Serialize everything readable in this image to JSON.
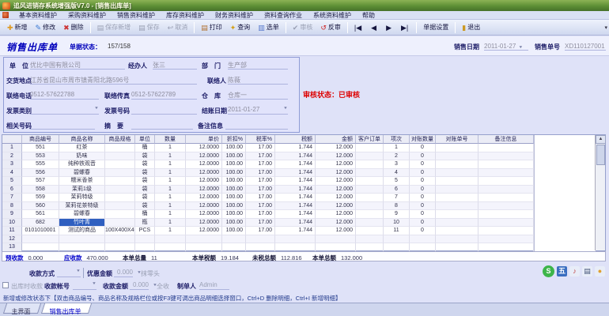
{
  "colors": {
    "accent": "#0000cc",
    "audit_red": "#dd0000",
    "selection": "#2f5fc0",
    "titlebar_green": "#5d8f35"
  },
  "window": {
    "title": "追风进销存系统增强版V7.0 - [销售出库单]"
  },
  "menu_bar": {
    "items": [
      "基本资料维护",
      "采购资料维护",
      "销售资料维护",
      "库存资料维护",
      "财务资料维护",
      "资料查询作业",
      "系统资料维护",
      "帮助"
    ]
  },
  "toolbar": {
    "items": [
      {
        "name": "new-button",
        "label": "新增",
        "icon": "✚",
        "color": "#e09a20"
      },
      {
        "name": "edit-button",
        "label": "修改",
        "icon": "✎",
        "color": "#3a7ad4"
      },
      {
        "name": "delete-button",
        "label": "删除",
        "icon": "✖",
        "color": "#cc3333"
      },
      {
        "sep": true
      },
      {
        "name": "save-new-button",
        "label": "保存新增",
        "icon": "▤",
        "disabled": true
      },
      {
        "name": "save-button",
        "label": "保存",
        "icon": "▤",
        "disabled": true
      },
      {
        "name": "cancel-button",
        "label": "取消",
        "icon": "↩",
        "disabled": true
      },
      {
        "sep": true
      },
      {
        "name": "print-button",
        "label": "打印",
        "icon": "▤",
        "color": "#b07030"
      },
      {
        "name": "query-button",
        "label": "查询",
        "icon": "✦",
        "color": "#d4a017"
      },
      {
        "name": "select-order-button",
        "label": "选单",
        "icon": "▥",
        "color": "#5577cc"
      },
      {
        "sep": true
      },
      {
        "name": "audit-button",
        "label": "审核",
        "icon": "✔",
        "disabled": true
      },
      {
        "name": "reverse-audit-button",
        "label": "反审",
        "icon": "↺",
        "color": "#cc2222"
      },
      {
        "sep": true
      },
      {
        "name": "nav-first-button",
        "icon": "|◀",
        "color": "#16163f"
      },
      {
        "name": "nav-prev-button",
        "icon": "◀",
        "color": "#16163f"
      },
      {
        "name": "nav-next-button",
        "icon": "▶",
        "color": "#16163f"
      },
      {
        "name": "nav-last-button",
        "icon": "▶|",
        "color": "#16163f"
      },
      {
        "sep": true
      },
      {
        "name": "doc-settings-button",
        "label": "单据设置"
      },
      {
        "sep": true
      },
      {
        "name": "exit-button",
        "label": "退出",
        "icon": "▮",
        "color": "#cc9922"
      }
    ]
  },
  "doc_header": {
    "title": "销售出库单",
    "status_label": "单据状态：",
    "status_value": "157/158",
    "date_label": "销售日期",
    "date_value": "2011-01-27",
    "no_label": "销售单号",
    "no_value": "XD110127001"
  },
  "form": {
    "unit_label": "单　位",
    "unit_value": "优比中国有限公司",
    "agent_label": "经办人",
    "agent_value": "张三",
    "dept_label": "部　门",
    "dept_value": "生产部",
    "address_label": "交货地点",
    "address_value": "江苏省昆山市周市镇青阳北路596号",
    "contact_label": "联络人",
    "contact_value": "陈薇",
    "phone_label": "联络电话",
    "phone_value": "0512-57622788",
    "fax_label": "联络传真",
    "fax_value": "0512-57622789",
    "warehouse_label": "仓　库",
    "warehouse_value": "仓库一",
    "invoice_type_label": "发票类别",
    "invoice_type_value": "",
    "invoice_no_label": "发票号码",
    "invoice_no_value": "",
    "settle_date_label": "结账日期",
    "settle_date_value": "2011-01-27",
    "ref_no_label": "相关号码",
    "ref_no_value": "",
    "summary_label": "摘　要",
    "summary_value": "",
    "remark_label": "备注信息",
    "remark_value": ""
  },
  "audit_status": {
    "text": "审核状态：已审核"
  },
  "table": {
    "columns": [
      "商品编号",
      "商品名称",
      "商品规格",
      "单位",
      "数量",
      "单价",
      "折扣%",
      "税率%",
      "税额",
      "金额",
      "客户订单",
      "项次",
      "对账数量",
      "对账单号",
      "备注信息"
    ],
    "rows": [
      [
        "551",
        "红茶",
        "",
        "桶",
        "1",
        "12.0000",
        "100.00",
        "17.00",
        "1.744",
        "12.000",
        "",
        "1",
        "0",
        "",
        ""
      ],
      [
        "553",
        "奶味",
        "",
        "袋",
        "1",
        "12.0000",
        "100.00",
        "17.00",
        "1.744",
        "12.000",
        "",
        "2",
        "0",
        "",
        ""
      ],
      [
        "555",
        "纯种铁观音",
        "",
        "袋",
        "1",
        "12.0000",
        "100.00",
        "17.00",
        "1.744",
        "12.000",
        "",
        "3",
        "0",
        "",
        ""
      ],
      [
        "556",
        "碧螺春",
        "",
        "袋",
        "1",
        "12.0000",
        "100.00",
        "17.00",
        "1.744",
        "12.000",
        "",
        "4",
        "0",
        "",
        ""
      ],
      [
        "557",
        "糯米香茶",
        "",
        "袋",
        "1",
        "12.0000",
        "100.00",
        "17.00",
        "1.744",
        "12.000",
        "",
        "5",
        "0",
        "",
        ""
      ],
      [
        "558",
        "茉莉1级",
        "",
        "袋",
        "1",
        "12.0000",
        "100.00",
        "17.00",
        "1.744",
        "12.000",
        "",
        "6",
        "0",
        "",
        ""
      ],
      [
        "559",
        "茉莉特级",
        "",
        "袋",
        "1",
        "12.0000",
        "100.00",
        "17.00",
        "1.744",
        "12.000",
        "",
        "7",
        "0",
        "",
        ""
      ],
      [
        "560",
        "茉莉花茶特级",
        "",
        "袋",
        "1",
        "12.0000",
        "100.00",
        "17.00",
        "1.744",
        "12.000",
        "",
        "8",
        "0",
        "",
        ""
      ],
      [
        "561",
        "碧螺春",
        "",
        "桶",
        "1",
        "12.0000",
        "100.00",
        "17.00",
        "1.744",
        "12.000",
        "",
        "9",
        "0",
        "",
        ""
      ],
      [
        "682",
        "竹叶青",
        "",
        "瓶",
        "1",
        "12.0000",
        "100.00",
        "17.00",
        "1.744",
        "12.000",
        "",
        "10",
        "0",
        "",
        ""
      ],
      [
        "0101010001",
        "测试的商品",
        "100X400X40",
        "PCS",
        "1",
        "12.0000",
        "100.00",
        "17.00",
        "1.744",
        "12.000",
        "",
        "11",
        "0",
        "",
        ""
      ]
    ],
    "extra_row_numbers": [
      "12",
      "13"
    ],
    "selected": {
      "row": 9,
      "col": 1
    }
  },
  "totals": {
    "items": [
      {
        "label": "预收款",
        "value": "0.000",
        "accent": true
      },
      {
        "label": "应收款",
        "value": "470.000",
        "accent": true
      },
      {
        "label": "本单总量",
        "value": "11"
      },
      {
        "label": "本单税额",
        "value": "19.184"
      },
      {
        "label": "未税总额",
        "value": "112.816"
      },
      {
        "label": "本单总额",
        "value": "132.000"
      }
    ]
  },
  "payment": {
    "method_label": "收款方式",
    "method_value": "",
    "discount_label": "优惠金额",
    "discount_value": "0.000",
    "discount_suffix": "抹零头",
    "checkbox_label": "出库时收款",
    "account_label": "收款帐号",
    "account_value": "",
    "amount_label": "收款金额",
    "amount_value": "0.000",
    "amount_suffix": "全收",
    "maker_label": "制单人",
    "maker_value": "Admin"
  },
  "tray": [
    {
      "name": "green-s-tray-icon",
      "glyph": "S",
      "bg": "#3db54a",
      "fg": "#ffffff",
      "round": true
    },
    {
      "name": "wubi-input-icon",
      "glyph": "五",
      "bg": "#3a6ec0",
      "fg": "#ffffff"
    },
    {
      "name": "music-note-icon",
      "glyph": "♪",
      "bg": "#e8edf8",
      "fg": "#c04040"
    },
    {
      "name": "keyboard-icon",
      "glyph": "▤",
      "bg": "#e8edf8",
      "fg": "#445577"
    },
    {
      "name": "orange-dot-icon",
      "glyph": "●",
      "bg": "#e8edf8",
      "fg": "#e0a030"
    }
  ],
  "hint": "新增或修改状态下【双击商品编号、商品名称及规格栏位或按F3键可调出商品明细选择窗口，Ctrl+D 删除明细，Ctrl+I 新增明细】",
  "status_bar": {
    "tabs": [
      {
        "label": "主界面",
        "active": false
      },
      {
        "label": "销售出库单",
        "active": true
      }
    ]
  }
}
